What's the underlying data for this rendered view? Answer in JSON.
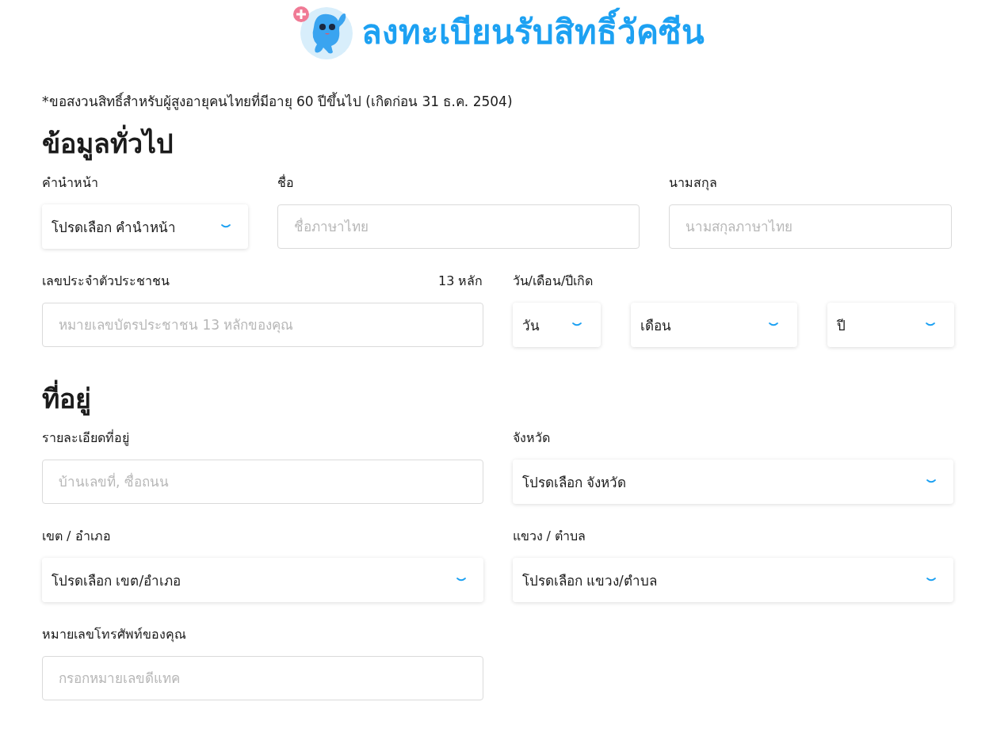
{
  "header": {
    "title": "ลงทะเบียนรับสิทธิ์วัคซีน"
  },
  "notice": "*ขอสงวนสิทธิ์สำหรับผู้สูงอายุคนไทยที่มีอายุ 60 ปีขึ้นไป (เกิดก่อน 31 ธ.ค. 2504)",
  "sections": [
    {
      "title": "ข้อมูลทั่วไป",
      "fields": [
        {
          "kind": "select",
          "label": "คำนำหน้า",
          "value": "โปรดเลือก คำนำหน้า"
        },
        {
          "kind": "text",
          "label": "ชื่อ",
          "placeholder": "ชื่อภาษาไทย"
        },
        {
          "kind": "text",
          "label": "นามสกุล",
          "placeholder": "นามสกุลภาษาไทย"
        },
        {
          "kind": "text",
          "label": "เลขประจำตัวประชาชน",
          "hint": "13 หลัก",
          "placeholder": "หมายเลขบัตรประชาชน 13 หลักของคุณ"
        },
        {
          "kind": "group",
          "label": "วัน/เดือน/ปีเกิด",
          "parts": [
            {
              "kind": "select",
              "value": "วัน"
            },
            {
              "kind": "select",
              "value": "เดือน"
            },
            {
              "kind": "select",
              "value": "ปี"
            }
          ]
        }
      ]
    },
    {
      "title": "ที่อยู่",
      "fields": [
        {
          "kind": "text",
          "label": "รายละเอียดที่อยู่",
          "placeholder": "บ้านเลขที่, ซื่อถนน"
        },
        {
          "kind": "select",
          "label": "จังหวัด",
          "value": "โปรดเลือก จังหวัด"
        },
        {
          "kind": "select",
          "label": "เขต / อำเภอ",
          "value": "โปรดเลือก เขต/อำเภอ"
        },
        {
          "kind": "select",
          "label": "แขวง / ตำบล",
          "value": "โปรดเลือก แขวง/ตำบล"
        },
        {
          "kind": "text",
          "label": "หมายเลขโทรศัพท์ของคุณ",
          "placeholder": "กรอกหมายเลขดีแทค"
        }
      ]
    }
  ]
}
